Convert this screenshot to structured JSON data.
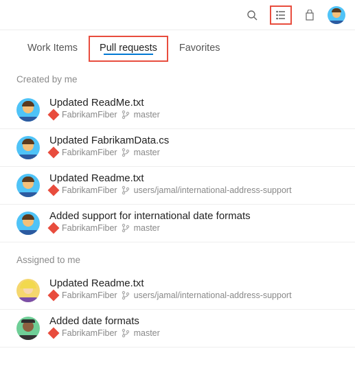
{
  "tabs": [
    {
      "label": "Work Items",
      "active": false,
      "highlight": false
    },
    {
      "label": "Pull requests",
      "active": true,
      "highlight": true
    },
    {
      "label": "Favorites",
      "active": false,
      "highlight": false
    }
  ],
  "sections": [
    {
      "title": "Created by me",
      "items": [
        {
          "title": "Updated ReadMe.txt",
          "repo": "FabrikamFiber",
          "branch": "master",
          "avatar": "blue"
        },
        {
          "title": "Updated FabrikamData.cs",
          "repo": "FabrikamFiber",
          "branch": "master",
          "avatar": "blue"
        },
        {
          "title": "Updated Readme.txt",
          "repo": "FabrikamFiber",
          "branch": "users/jamal/international-address-support",
          "avatar": "blue"
        },
        {
          "title": "Added support for international date formats",
          "repo": "FabrikamFiber",
          "branch": "master",
          "avatar": "blue"
        }
      ]
    },
    {
      "title": "Assigned to me",
      "items": [
        {
          "title": "Updated Readme.txt",
          "repo": "FabrikamFiber",
          "branch": "users/jamal/international-address-support",
          "avatar": "yellow"
        },
        {
          "title": "Added date formats",
          "repo": "FabrikamFiber",
          "branch": "master",
          "avatar": "teal"
        }
      ]
    }
  ]
}
